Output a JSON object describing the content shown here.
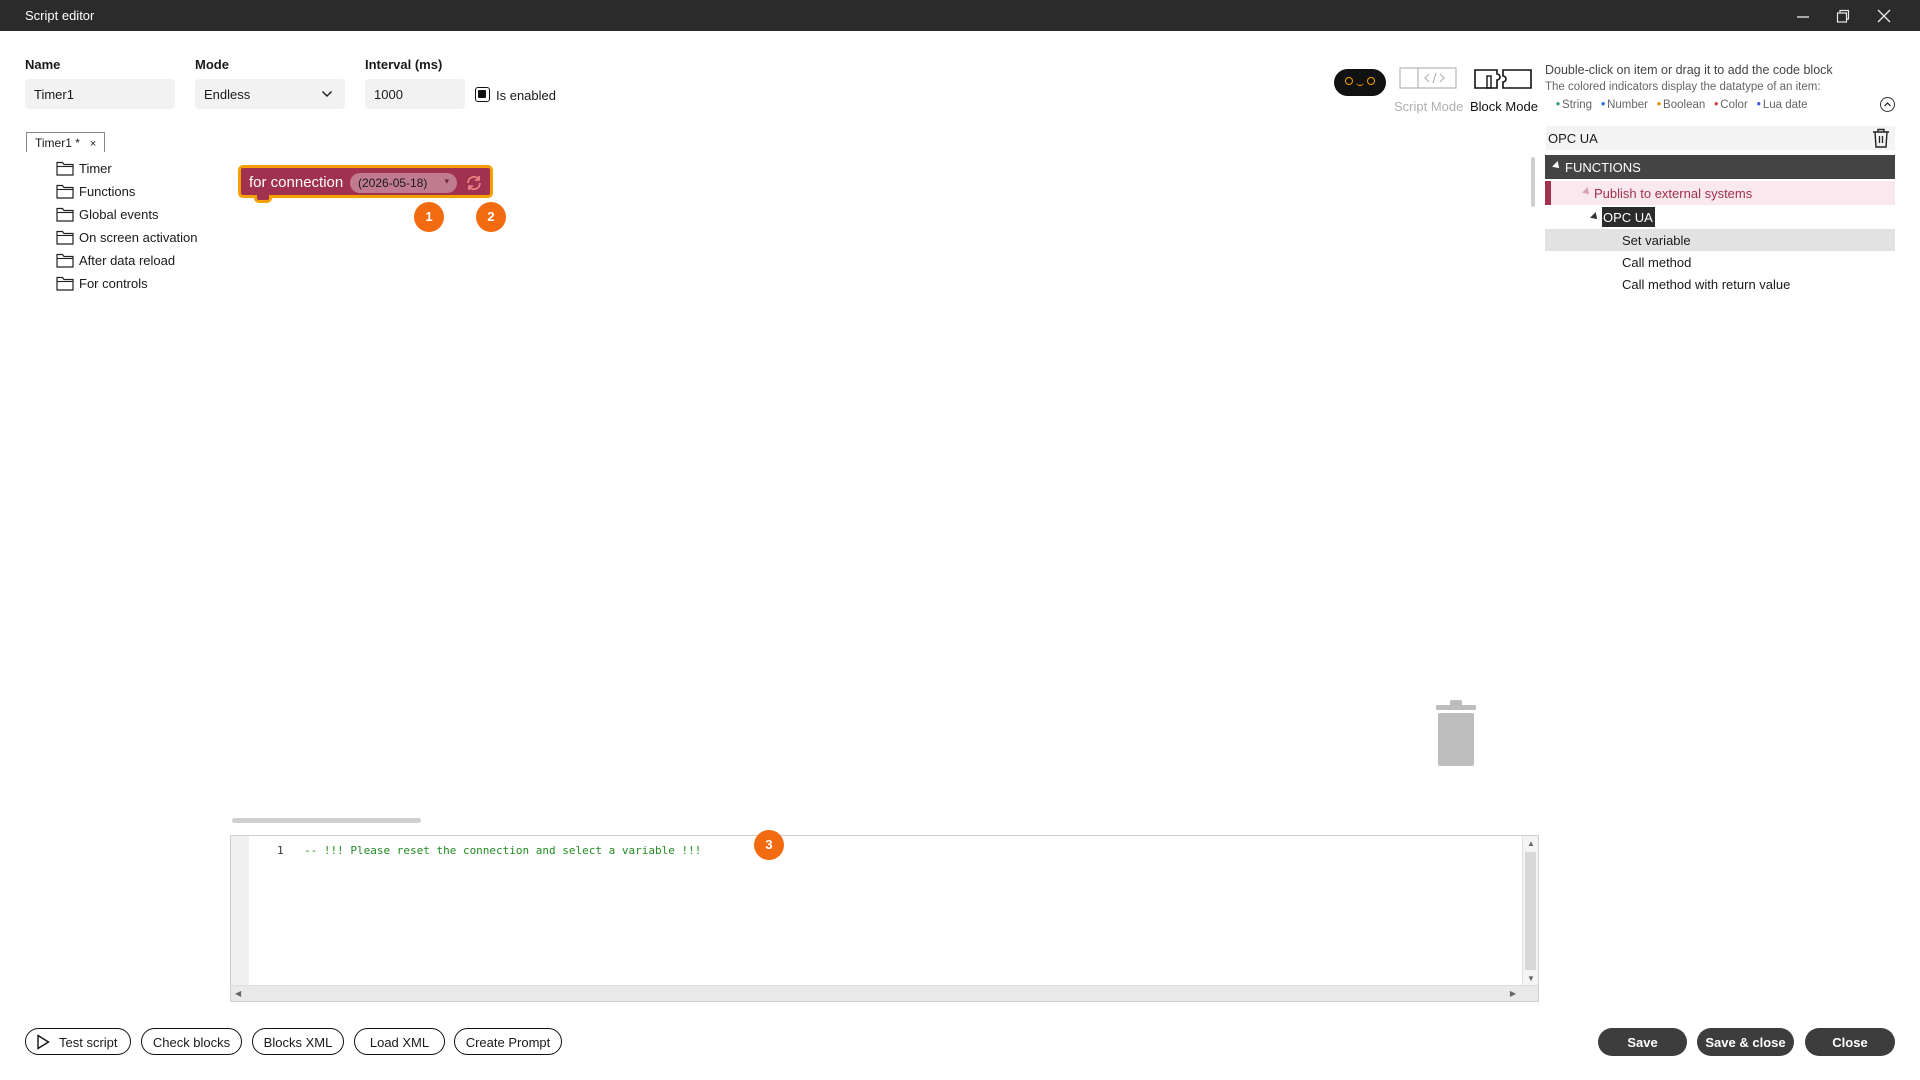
{
  "window": {
    "title": "Script editor",
    "buttons": [
      "minimize-icon",
      "restore-icon",
      "close-icon"
    ]
  },
  "form": {
    "name_label": "Name",
    "name_value": "Timer1",
    "mode_label": "Mode",
    "mode_value": "Endless",
    "interval_label": "Interval (ms)",
    "interval_value": "1000",
    "enabled_label": "Is enabled",
    "enabled_checked": true
  },
  "mode_switch": {
    "script_mode_label": "Script Mode",
    "block_mode_label": "Block Mode",
    "active": "Block Mode"
  },
  "hint": {
    "line1": "Double-click on item or drag it to add the code block",
    "line2": "The colored indicators display the datatype of an item:",
    "types": [
      {
        "label": "String",
        "color": "#2e9e6b"
      },
      {
        "label": "Number",
        "color": "#1f6fd1"
      },
      {
        "label": "Boolean",
        "color": "#e08a00"
      },
      {
        "label": "Color",
        "color": "#d63a3a"
      },
      {
        "label": "Lua date",
        "color": "#3a5bd6"
      }
    ]
  },
  "script_tab": {
    "label": "Timer1 *",
    "close": "×"
  },
  "tree": {
    "items": [
      {
        "label": "Timer"
      },
      {
        "label": "Functions"
      },
      {
        "label": "Global events"
      },
      {
        "label": "On screen activation"
      },
      {
        "label": "After data reload"
      },
      {
        "label": "For controls"
      }
    ]
  },
  "workspace": {
    "block": {
      "label": "for connection",
      "dropdown_value": "(2026-05-18)",
      "dropdown_arrow": "▾",
      "color": "#a0314f",
      "highlight": "#f5a000"
    },
    "badges": [
      "1",
      "2",
      "3"
    ]
  },
  "code": {
    "lines": [
      {
        "number": "1",
        "text": "-- !!! Please reset the connection and select a variable !!!"
      }
    ]
  },
  "right_panel": {
    "search_value": "OPC UA",
    "functions_header": "FUNCTIONS",
    "publish_label": "Publish to external systems",
    "opc_label": "OPC UA",
    "items": [
      {
        "label": "Set variable",
        "selected": true
      },
      {
        "label": "Call method",
        "selected": false
      },
      {
        "label": "Call method with return value",
        "selected": false
      }
    ]
  },
  "footer": {
    "left_buttons": [
      "Test script",
      "Check blocks",
      "Blocks XML",
      "Load XML",
      "Create Prompt"
    ],
    "save": "Save",
    "save_close": "Save & close",
    "close": "Close"
  }
}
